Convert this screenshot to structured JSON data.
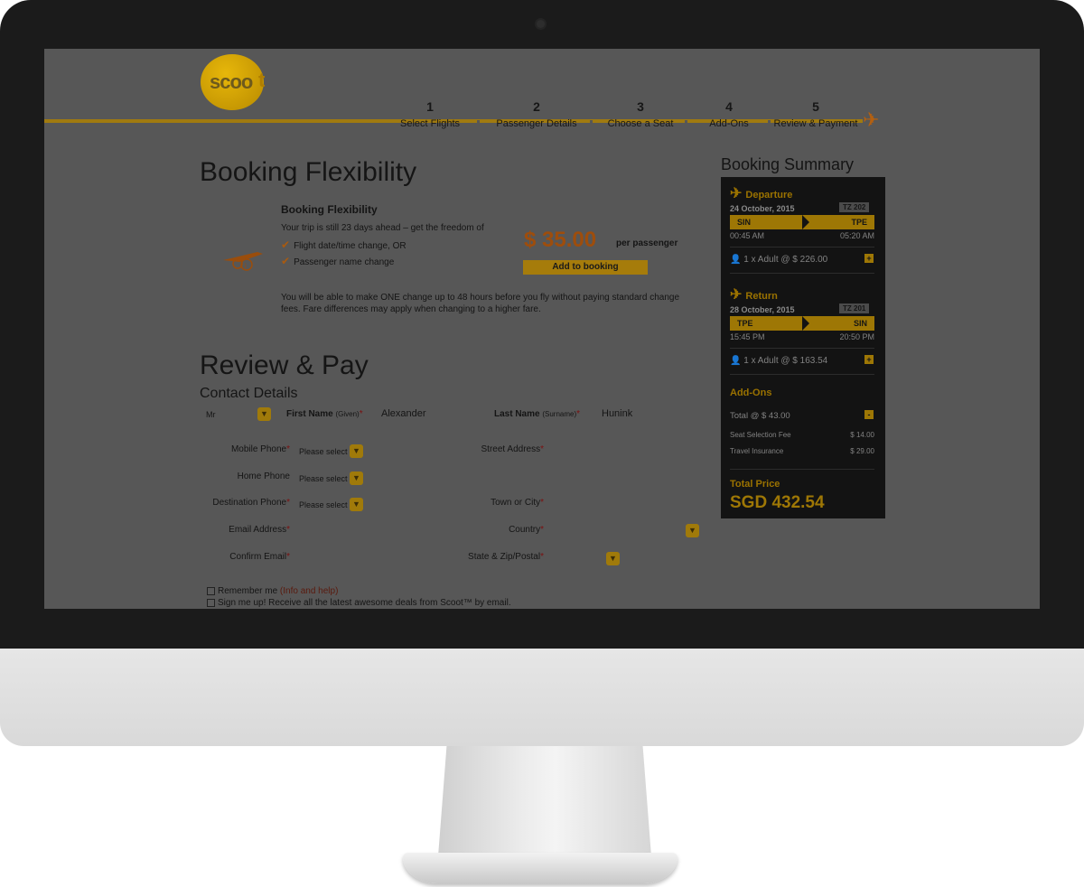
{
  "brand": {
    "logo_text": "scoo",
    "logo_tail": "t"
  },
  "steps": [
    {
      "num": "1",
      "label": "Select Flights"
    },
    {
      "num": "2",
      "label": "Passenger Details"
    },
    {
      "num": "3",
      "label": "Choose a Seat"
    },
    {
      "num": "4",
      "label": "Add-Ons"
    },
    {
      "num": "5",
      "label": "Review & Payment"
    }
  ],
  "flex": {
    "title": "Booking Flexibility",
    "subtitle": "Booking Flexibility",
    "intro": "Your trip is still 23 days ahead – get the freedom of",
    "benefit1": "Flight date/time change, OR",
    "benefit2": "Passenger name change",
    "note_line1": "You will be able to make ONE change up to 48 hours before you fly without paying standard change",
    "note_line2": "fees. Fare differences may apply when changing to a higher fare.",
    "price": "$ 35.00",
    "per": "per passenger",
    "add_button": "Add to booking"
  },
  "review": {
    "title": "Review & Pay",
    "contact_title": "Contact Details"
  },
  "form": {
    "title_value": "Mr",
    "first_label": "First Name",
    "first_hint": "(Given)",
    "first_value": "Alexander",
    "last_label": "Last Name",
    "last_hint": "(Surname)",
    "last_value": "Hunink",
    "mobile_label": "Mobile Phone",
    "home_label": "Home Phone",
    "dest_label": "Destination Phone",
    "email_label": "Email Address",
    "confirm_label": "Confirm Email",
    "street_label": "Street Address",
    "town_label": "Town or City",
    "country_label": "Country",
    "state_label": "State & Zip/Postal",
    "please_select": "Please select",
    "req": "*",
    "remember": "Remember me ",
    "remember_link": "(Info and help)",
    "signup": "Sign me up! Receive all the latest awesome deals from Scoot™ by email."
  },
  "summary": {
    "title": "Booking Summary",
    "departure": {
      "label": "Departure",
      "code": "TZ 202",
      "date": "24 October, 2015",
      "from": "SIN",
      "to": "TPE",
      "dep_time": "00:45 AM",
      "arr_time": "05:20 AM",
      "pax": "1 x Adult @ $ 226.00"
    },
    "return": {
      "label": "Return",
      "code": "TZ 201",
      "date": "28 October, 2015",
      "from": "TPE",
      "to": "SIN",
      "dep_time": "15:45 PM",
      "arr_time": "20:50 PM",
      "pax": "1 x Adult @ $ 163.54"
    },
    "addons": {
      "label": "Add-Ons",
      "total": "Total @ $ 43.00",
      "seat_label": "Seat Selection Fee",
      "seat_price": "$ 14.00",
      "ins_label": "Travel Insurance",
      "ins_price": "$ 29.00"
    },
    "total_label": "Total Price",
    "total_value": "SGD 432.54",
    "plus": "+",
    "minus": "-"
  },
  "colors": {
    "accent": "#f0b400",
    "screen_dim": "#575757",
    "panel": "#131313"
  }
}
